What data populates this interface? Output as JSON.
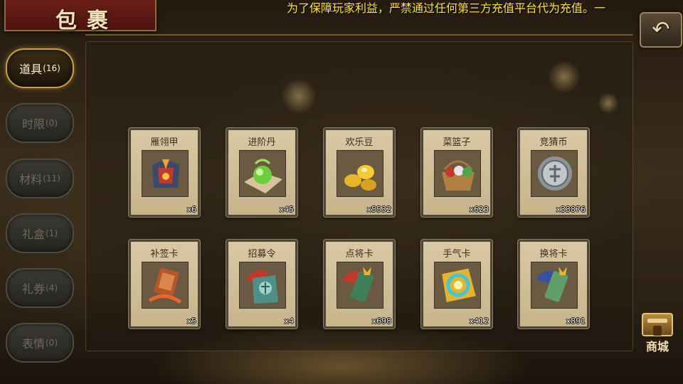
{
  "title": "包裹",
  "notice": "为了保障玩家利益，严禁通过任何第三方充值平台代为充值。一",
  "back_button_glyph": "↶",
  "tabs": [
    {
      "label": "道具",
      "count": "(16)",
      "active": true
    },
    {
      "label": "时限",
      "count": "(0)",
      "active": false
    },
    {
      "label": "材料",
      "count": "(11)",
      "active": false
    },
    {
      "label": "礼盒",
      "count": "(1)",
      "active": false
    },
    {
      "label": "礼券",
      "count": "(4)",
      "active": false
    },
    {
      "label": "表情",
      "count": "(0)",
      "active": false
    }
  ],
  "items": [
    {
      "name": "雁翎甲",
      "qty": "x6",
      "icon": "armor-icon"
    },
    {
      "name": "进阶丹",
      "qty": "x45",
      "icon": "pill-icon"
    },
    {
      "name": "欢乐豆",
      "qty": "x5532",
      "icon": "gold-beans-icon"
    },
    {
      "name": "菜篮子",
      "qty": "x623",
      "icon": "basket-icon"
    },
    {
      "name": "竞猜币",
      "qty": "x33876",
      "icon": "silver-coin-icon"
    },
    {
      "name": "补签卡",
      "qty": "x5",
      "icon": "signin-card-icon"
    },
    {
      "name": "招募令",
      "qty": "x4",
      "icon": "recruit-token-icon"
    },
    {
      "name": "点将卡",
      "qty": "x698",
      "icon": "general-card-icon"
    },
    {
      "name": "手气卡",
      "qty": "x412",
      "icon": "luck-card-icon"
    },
    {
      "name": "换将卡",
      "qty": "x891",
      "icon": "swap-card-icon"
    }
  ],
  "shop_button": {
    "label": "商城"
  },
  "colors": {
    "notice": "#ffe44a",
    "active_tab_border": "#c9a044",
    "card_bg": "#d9c8a4"
  }
}
